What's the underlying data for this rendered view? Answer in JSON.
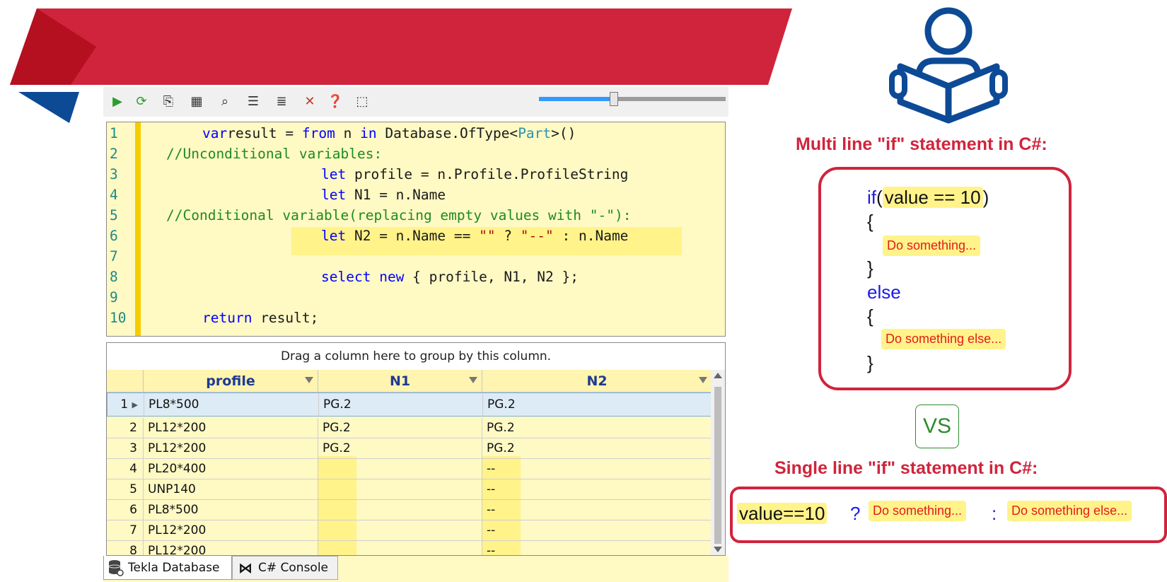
{
  "toolbar": {
    "icons": [
      "run-icon",
      "refresh-icon",
      "copy-clipboard-icon",
      "table-icon",
      "search-properties-icon",
      "list-icon",
      "help-list-icon",
      "clear-icon",
      "help-icon",
      "layout-icon"
    ],
    "zoom_fraction": 0.4
  },
  "editor": {
    "line_numbers": [
      "1",
      "2",
      "3",
      "4",
      "5",
      "6",
      "7",
      "8",
      "9",
      "10"
    ],
    "lines": [
      [
        [
          "kw",
          "var"
        ],
        [
          "",
          "result = "
        ],
        [
          "kw",
          "from"
        ],
        [
          "",
          " n "
        ],
        [
          "kw",
          "in"
        ],
        [
          "",
          " Database.OfType<"
        ],
        [
          "ty",
          "Part"
        ],
        [
          "",
          ">()"
        ]
      ],
      [
        [
          "cm",
          "//Unconditional variables:"
        ]
      ],
      [
        [
          "kw",
          "let"
        ],
        [
          "",
          " profile = n.Profile.ProfileString"
        ]
      ],
      [
        [
          "kw",
          "let"
        ],
        [
          "",
          " N1 = n.Name"
        ]
      ],
      [
        [
          "cm",
          "//Conditional variable(replacing empty values with \"-\"):"
        ]
      ],
      [
        [
          "kw",
          "let"
        ],
        [
          "",
          " N2 = n.Name == "
        ],
        [
          "st",
          "\"\""
        ],
        [
          "",
          " ? "
        ],
        [
          "st",
          "\"--\""
        ],
        [
          "",
          " : n.Name"
        ]
      ],
      [],
      [
        [
          "kw",
          "select"
        ],
        [
          "",
          " "
        ],
        [
          "kw",
          "new"
        ],
        [
          "",
          " { profile, N1, N2 };"
        ]
      ],
      [],
      [
        [
          "kw",
          "return"
        ],
        [
          "",
          " result;"
        ]
      ]
    ]
  },
  "grid": {
    "group_panel_text": "Drag a column here to group by this column.",
    "columns": [
      "profile",
      "N1",
      "N2"
    ],
    "rows": [
      {
        "num": "1",
        "profile": "PL8*500",
        "n1": "PG.2",
        "n2": "PG.2"
      },
      {
        "num": "2",
        "profile": "PL12*200",
        "n1": "PG.2",
        "n2": "PG.2"
      },
      {
        "num": "3",
        "profile": "PL12*200",
        "n1": "PG.2",
        "n2": "PG.2"
      },
      {
        "num": "4",
        "profile": "PL20*400",
        "n1": "",
        "n2": "--"
      },
      {
        "num": "5",
        "profile": "UNP140",
        "n1": "",
        "n2": "--"
      },
      {
        "num": "6",
        "profile": "PL8*500",
        "n1": "",
        "n2": "--"
      },
      {
        "num": "7",
        "profile": "PL12*200",
        "n1": "",
        "n2": "--"
      },
      {
        "num": "8",
        "profile": "PL12*200",
        "n1": "",
        "n2": "--"
      }
    ]
  },
  "tabs": {
    "tekla": "Tekla Database",
    "console": "C# Console"
  },
  "right": {
    "multi_title": "Multi line \"if\" statement in C#:",
    "if_kw": "if",
    "open_paren": "(",
    "condition": "value == 10",
    "close_paren": ")",
    "brace_open": "{",
    "brace_close": "}",
    "do_something": "Do something...",
    "else_kw": "else",
    "do_something_else": "Do something else...",
    "vs": "VS",
    "single_title": "Single line \"if\" statement in C#:",
    "single_condition": "value==10",
    "question": "?",
    "colon": ":"
  },
  "colors": {
    "brand_red": "#d0243c",
    "brand_blue": "#0d4a96",
    "editor_bg": "#fff9c4",
    "highlight": "#fff38a"
  }
}
